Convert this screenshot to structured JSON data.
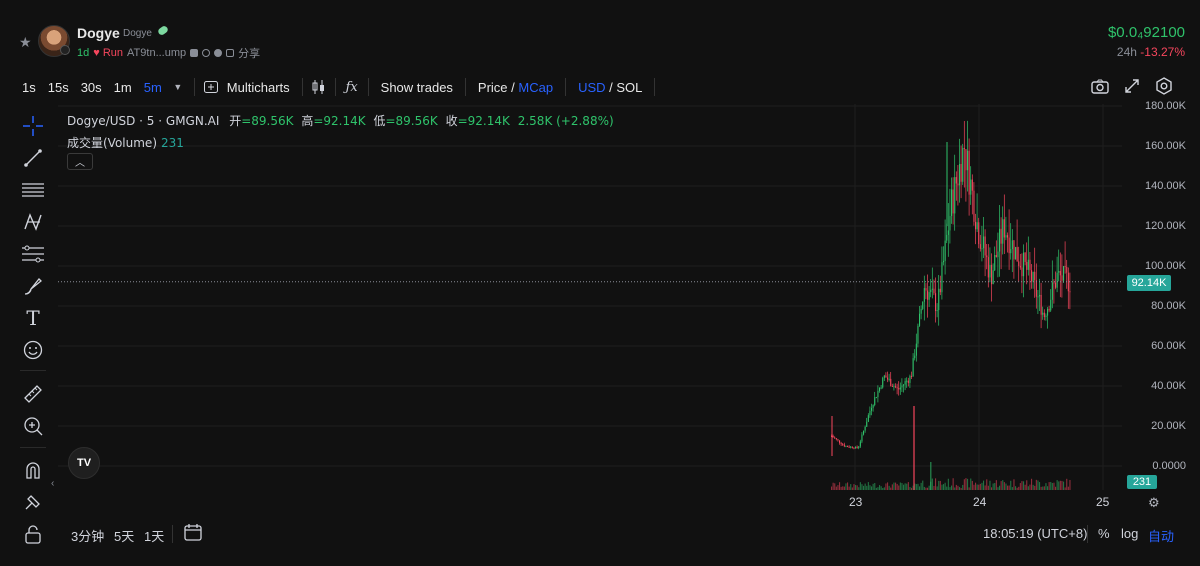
{
  "header": {
    "token_name": "Dogye",
    "token_symbol": "Dogye",
    "age": "1d",
    "run_label": "Run",
    "address": "AT9tn...ump",
    "share_label": "分享",
    "price": "$0.0₄92100",
    "change_label": "24h",
    "change_value": "-13.27%"
  },
  "toolbar": {
    "intervals": [
      "1s",
      "15s",
      "30s",
      "1m",
      "5m"
    ],
    "active_interval": "5m",
    "multicharts_label": "Multicharts",
    "show_trades_label": "Show trades",
    "price_label": "Price",
    "mcap_label": "MCap",
    "usd_label": "USD",
    "sol_label": "SOL"
  },
  "legend": {
    "pair": "Dogye/USD · 5 · GMGN.AI",
    "open_label": "开",
    "open": "=89.56K",
    "high_label": "高",
    "high": "=92.14K",
    "low_label": "低",
    "low": "=89.56K",
    "close_label": "收",
    "close": "=92.14K",
    "change": "2.58K (+2.88%)",
    "volume_label": "成交量(Volume)",
    "volume_value": "231"
  },
  "axis": {
    "y_labels": [
      "180.00K",
      "160.00K",
      "140.00K",
      "120.00K",
      "100.00K",
      "80.00K",
      "60.00K",
      "40.00K",
      "20.00K",
      "0.0000"
    ],
    "current_price_tag": "92.14K",
    "volume_tag": "231",
    "x_labels": [
      "23",
      "24",
      "25"
    ]
  },
  "bottom": {
    "ranges": [
      "3分钟",
      "5天",
      "1天"
    ],
    "clock": "18:05:19 (UTC+8)",
    "percent_label": "%",
    "log_label": "log",
    "auto_label": "自动"
  },
  "colors": {
    "up": "#2fc36b",
    "down": "#f6465d",
    "accent": "#2962ff",
    "tag": "#26a69a"
  },
  "chart_data": {
    "type": "candlestick",
    "ylim": [
      0,
      180000
    ],
    "x_ticks": [
      "23",
      "24",
      "25"
    ],
    "approx_price_path": [
      {
        "t": "22 20:00",
        "v": 15000
      },
      {
        "t": "22 22:00",
        "v": 10000
      },
      {
        "t": "23 00:00",
        "v": 9000
      },
      {
        "t": "23 02:00",
        "v": 30000
      },
      {
        "t": "23 04:00",
        "v": 45000
      },
      {
        "t": "23 06:00",
        "v": 38000
      },
      {
        "t": "23 09:00",
        "v": 45000
      },
      {
        "t": "23 11:00",
        "v": 90000
      },
      {
        "t": "23 13:00",
        "v": 80000
      },
      {
        "t": "23 15:00",
        "v": 130000
      },
      {
        "t": "23 16:00",
        "v": 160000
      },
      {
        "t": "23 18:00",
        "v": 120000
      },
      {
        "t": "23 20:00",
        "v": 95000
      },
      {
        "t": "24 00:00",
        "v": 120000
      },
      {
        "t": "24 03:00",
        "v": 105000
      },
      {
        "t": "24 06:00",
        "v": 95000
      },
      {
        "t": "24 09:00",
        "v": 75000
      },
      {
        "t": "24 11:00",
        "v": 95000
      },
      {
        "t": "24 13:00",
        "v": 92140
      }
    ],
    "last_close": 92140,
    "last_volume": 231
  }
}
